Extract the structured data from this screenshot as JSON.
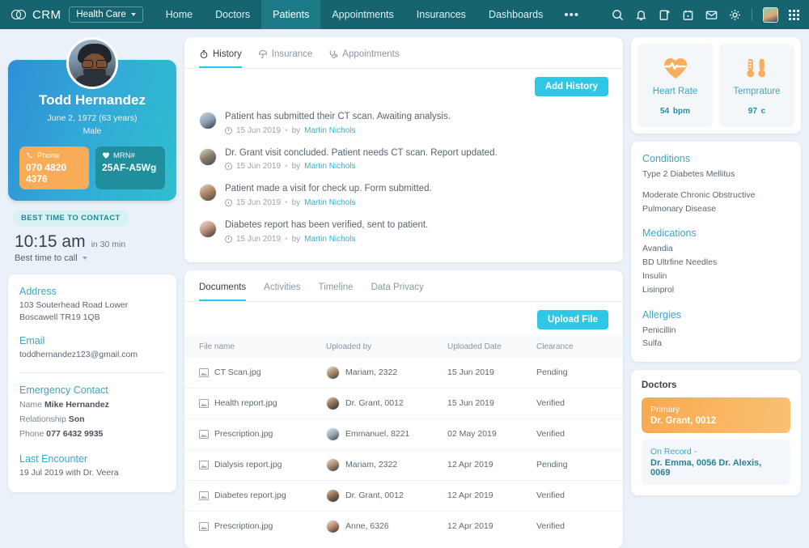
{
  "topnav": {
    "logo_text": "CRM",
    "department": "Health Care",
    "links": [
      {
        "label": "Home",
        "active": false
      },
      {
        "label": "Doctors",
        "active": false
      },
      {
        "label": "Patients",
        "active": true
      },
      {
        "label": "Appointments",
        "active": false
      },
      {
        "label": "Insurances",
        "active": false
      },
      {
        "label": "Dashboards",
        "active": false
      }
    ],
    "more": "•••"
  },
  "patient": {
    "name": "Todd Hernandez",
    "dob": "June 2, 1972 (63 years)",
    "gender": "Male",
    "phone_label": "Phone",
    "phone_value": "070 4820 4376",
    "mrn_label": "MRN#",
    "mrn_value": "25AF-A5Wg",
    "best_time_pill": "BEST TIME TO CONTACT",
    "best_time": "10:15 am",
    "best_time_rel": "in 30 min",
    "best_time_label": "Best time to call"
  },
  "contact": {
    "address_h": "Address",
    "address": "103  Souterhead Road Lower Boscawell TR19 1QB",
    "email_h": "Email",
    "email": "toddhernandez123@gmail.com",
    "emergency_h": "Emergency Contact",
    "em_name_k": "Name",
    "em_name_v": "Mike Hernandez",
    "em_rel_k": "Relationship",
    "em_rel_v": "Son",
    "em_phone_k": "Phone",
    "em_phone_v": "077 6432 9935",
    "last_h": "Last Encounter",
    "last_v": "19 Jul 2019 with Dr. Veera"
  },
  "history_panel": {
    "tabs": [
      {
        "label": "History",
        "icon": "stopwatch-icon",
        "active": true
      },
      {
        "label": "Insurance",
        "icon": "umbrella-icon",
        "active": false
      },
      {
        "label": "Appointments",
        "icon": "stethoscope-icon",
        "active": false
      }
    ],
    "add_button": "Add History",
    "entries": [
      {
        "text": "Patient has submitted their CT scan. Awaiting analysis.",
        "date": "15 Jun 2019",
        "by_prefix": "by",
        "by": "Martin Nichols"
      },
      {
        "text": "Dr. Grant visit concluded. Patient needs CT scan. Report updated.",
        "date": "15 Jun 2019",
        "by_prefix": "by",
        "by": "Martin Nichols"
      },
      {
        "text": "Patient made a visit for check up. Form submitted.",
        "date": "15 Jun 2019",
        "by_prefix": "by",
        "by": "Martin Nichols"
      },
      {
        "text": "Diabetes report has been verified, sent to patient.",
        "date": "15 Jun 2019",
        "by_prefix": "by",
        "by": "Martin Nichols"
      }
    ]
  },
  "documents_panel": {
    "tabs": [
      {
        "label": "Documents",
        "active": true
      },
      {
        "label": "Activities",
        "active": false
      },
      {
        "label": "Timeline",
        "active": false
      },
      {
        "label": "Data Privacy",
        "active": false
      }
    ],
    "upload_button": "Upload  File",
    "columns": [
      "File name",
      "Uploaded by",
      "Uploaded Date",
      "Clearance"
    ],
    "rows": [
      {
        "file": "CT Scan.jpg",
        "by": "Mariam, 2322",
        "date": "15 Jun 2019",
        "clearance": "Pending"
      },
      {
        "file": "Health report.jpg",
        "by": "Dr. Grant, 0012",
        "date": "15 Jun 2019",
        "clearance": "Verified"
      },
      {
        "file": "Prescription.jpg",
        "by": "Emmanuel, 8221",
        "date": "02 May 2019",
        "clearance": "Verified"
      },
      {
        "file": "Dialysis report.jpg",
        "by": "Mariam, 2322",
        "date": "12 Apr 2019",
        "clearance": "Pending"
      },
      {
        "file": "Diabetes report.jpg",
        "by": "Dr. Grant, 0012",
        "date": "12 Apr 2019",
        "clearance": "Verified"
      },
      {
        "file": "Prescription.jpg",
        "by": "Anne, 6326",
        "date": "12 Apr 2019",
        "clearance": "Verified"
      }
    ]
  },
  "vitals": [
    {
      "name": "Heart Rate",
      "value": "54",
      "unit": "bpm",
      "icon": "heartbeat-icon"
    },
    {
      "name": "Temprature",
      "value": "97",
      "unit": "c",
      "icon": "thermometer-icon"
    }
  ],
  "clinical": {
    "conditions_h": "Conditions",
    "conditions": [
      "Type 2 Diabetes Mellitus",
      "Moderate Chronic Obstructive Pulmonary Disease"
    ],
    "medications_h": "Medications",
    "medications": [
      "Avandia",
      "BD Ultrfine Needles",
      "Insulin",
      "Lisinprol"
    ],
    "allergies_h": "Allergies",
    "allergies": [
      "Penicillin",
      "Sulfa"
    ]
  },
  "doctors": {
    "title": "Doctors",
    "primary_label": "Primary",
    "primary_value": "Dr. Grant, 0012",
    "record_label": "On Record -",
    "record_value": "Dr. Emma, 0056 Dr. Alexis, 0069"
  },
  "colors": {
    "nav_bg": "#156470",
    "nav_active": "#1d7b88",
    "accent_cyan": "#2ec8e6",
    "accent_orange": "#f8ac58",
    "link_blue": "#3ba7c7",
    "page_bg": "#eaf1f8"
  }
}
